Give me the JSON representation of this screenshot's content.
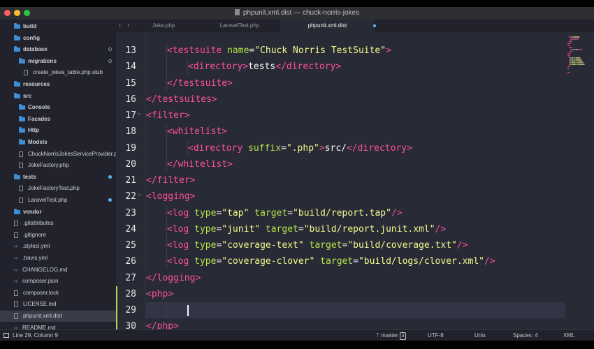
{
  "window": {
    "title": "phpunit.xml.dist — chuck-norris-jokes"
  },
  "colors": {
    "traffic_close": "#ff5f57",
    "traffic_minimize": "#febc2e",
    "traffic_zoom": "#28c840",
    "folder": "#3d8fd6",
    "modified_dot": "#5cb8f0",
    "git_added": "#b3d44b",
    "tag": "#ff4fa0",
    "attr": "#b3e34b",
    "string": "#f1fa8c"
  },
  "icons": {
    "back": "‹",
    "forward": "›",
    "fold": "⌄",
    "branch": "branch-icon"
  },
  "sidebar": {
    "items": [
      {
        "label": "build",
        "type": "folder",
        "depth": 0
      },
      {
        "label": "config",
        "type": "folder",
        "depth": 0
      },
      {
        "label": "database",
        "type": "folder",
        "depth": 0,
        "marker": "ring"
      },
      {
        "label": "migrations",
        "type": "folder",
        "depth": 1,
        "marker": "ring"
      },
      {
        "label": "create_jokes_table.php.stub",
        "type": "file",
        "depth": 2
      },
      {
        "label": "resources",
        "type": "folder",
        "depth": 0
      },
      {
        "label": "src",
        "type": "folder",
        "depth": 0
      },
      {
        "label": "Console",
        "type": "folder",
        "depth": 1
      },
      {
        "label": "Facades",
        "type": "folder",
        "depth": 1
      },
      {
        "label": "Http",
        "type": "folder",
        "depth": 1
      },
      {
        "label": "Models",
        "type": "folder",
        "depth": 1
      },
      {
        "label": "ChuckNorrisJokesServiceProvider.php",
        "type": "file",
        "depth": 1
      },
      {
        "label": "JokeFactory.php",
        "type": "file",
        "depth": 1
      },
      {
        "label": "tests",
        "type": "folder",
        "depth": 0,
        "marker": "dot"
      },
      {
        "label": "JokeFactoryTest.php",
        "type": "file",
        "depth": 1
      },
      {
        "label": "LaravelTest.php",
        "type": "file",
        "depth": 1,
        "marker": "dot"
      },
      {
        "label": "vendor",
        "type": "folder",
        "depth": 0
      },
      {
        "label": ".gitattributes",
        "type": "file",
        "depth": 0
      },
      {
        "label": ".gitignore",
        "type": "file",
        "depth": 0
      },
      {
        "label": ".styleci.yml",
        "type": "code",
        "depth": 0
      },
      {
        "label": ".travis.yml",
        "type": "code",
        "depth": 0
      },
      {
        "label": "CHANGELOG.md",
        "type": "code",
        "depth": 0
      },
      {
        "label": "composer.json",
        "type": "code",
        "depth": 0
      },
      {
        "label": "composer.lock",
        "type": "file",
        "depth": 0
      },
      {
        "label": "LICENSE.md",
        "type": "file",
        "depth": 0
      },
      {
        "label": "phpunit.xml.dist",
        "type": "file",
        "depth": 0,
        "selected": true
      },
      {
        "label": "README.md",
        "type": "code",
        "depth": 0
      }
    ]
  },
  "tabs": [
    {
      "label": "Joke.php",
      "active": false
    },
    {
      "label": "LaravelTest.php",
      "active": false
    },
    {
      "label": "phpunit.xml.dist",
      "active": true,
      "modified": true
    }
  ],
  "editor": {
    "lines": [
      {
        "n": "13",
        "indent": 1,
        "tokens": [
          [
            "tag",
            "<testsuite"
          ],
          [
            "text",
            " "
          ],
          [
            "attr",
            "name"
          ],
          [
            "punc",
            "="
          ],
          [
            "str",
            "\"Chuck Norris TestSuite\""
          ],
          [
            "tag",
            ">"
          ]
        ]
      },
      {
        "n": "14",
        "indent": 2,
        "tokens": [
          [
            "tag",
            "<directory"
          ],
          [
            "tag",
            ">"
          ],
          [
            "text",
            "tests"
          ],
          [
            "tag",
            "</directory"
          ],
          [
            "tag",
            ">"
          ]
        ]
      },
      {
        "n": "15",
        "indent": 1,
        "tokens": [
          [
            "tag",
            "</testsuite"
          ],
          [
            "tag",
            ">"
          ]
        ]
      },
      {
        "n": "16",
        "indent": 0,
        "tokens": [
          [
            "tag",
            "</testsuites"
          ],
          [
            "tag",
            ">"
          ]
        ]
      },
      {
        "n": "17",
        "indent": 0,
        "fold": true,
        "tokens": [
          [
            "tag",
            "<filter"
          ],
          [
            "tag",
            ">"
          ]
        ]
      },
      {
        "n": "18",
        "indent": 1,
        "tokens": [
          [
            "tag",
            "<whitelist"
          ],
          [
            "tag",
            ">"
          ]
        ]
      },
      {
        "n": "19",
        "indent": 2,
        "tokens": [
          [
            "tag",
            "<directory"
          ],
          [
            "text",
            " "
          ],
          [
            "attr",
            "suffix"
          ],
          [
            "punc",
            "="
          ],
          [
            "str",
            "\".php\""
          ],
          [
            "tag",
            ">"
          ],
          [
            "text",
            "src/"
          ],
          [
            "tag",
            "</directory"
          ],
          [
            "tag",
            ">"
          ]
        ]
      },
      {
        "n": "20",
        "indent": 1,
        "tokens": [
          [
            "tag",
            "</whitelist"
          ],
          [
            "tag",
            ">"
          ]
        ]
      },
      {
        "n": "21",
        "indent": 0,
        "tokens": [
          [
            "tag",
            "</filter"
          ],
          [
            "tag",
            ">"
          ]
        ]
      },
      {
        "n": "22",
        "indent": 0,
        "fold": true,
        "tokens": [
          [
            "tag",
            "<logging"
          ],
          [
            "tag",
            ">"
          ]
        ]
      },
      {
        "n": "23",
        "indent": 1,
        "tokens": [
          [
            "tag",
            "<log"
          ],
          [
            "text",
            " "
          ],
          [
            "attr",
            "type"
          ],
          [
            "punc",
            "="
          ],
          [
            "str",
            "\"tap\""
          ],
          [
            "text",
            " "
          ],
          [
            "attr",
            "target"
          ],
          [
            "punc",
            "="
          ],
          [
            "str",
            "\"build/report.tap\""
          ],
          [
            "tag",
            "/>"
          ]
        ]
      },
      {
        "n": "24",
        "indent": 1,
        "tokens": [
          [
            "tag",
            "<log"
          ],
          [
            "text",
            " "
          ],
          [
            "attr",
            "type"
          ],
          [
            "punc",
            "="
          ],
          [
            "str",
            "\"junit\""
          ],
          [
            "text",
            " "
          ],
          [
            "attr",
            "target"
          ],
          [
            "punc",
            "="
          ],
          [
            "str",
            "\"build/report.junit.xml\""
          ],
          [
            "tag",
            "/>"
          ]
        ]
      },
      {
        "n": "25",
        "indent": 1,
        "tokens": [
          [
            "tag",
            "<log"
          ],
          [
            "text",
            " "
          ],
          [
            "attr",
            "type"
          ],
          [
            "punc",
            "="
          ],
          [
            "str",
            "\"coverage-text\""
          ],
          [
            "text",
            " "
          ],
          [
            "attr",
            "target"
          ],
          [
            "punc",
            "="
          ],
          [
            "str",
            "\"build/coverage.txt\""
          ],
          [
            "tag",
            "/>"
          ]
        ]
      },
      {
        "n": "26",
        "indent": 1,
        "tokens": [
          [
            "tag",
            "<log"
          ],
          [
            "text",
            " "
          ],
          [
            "attr",
            "type"
          ],
          [
            "punc",
            "="
          ],
          [
            "str",
            "\"coverage-clover\""
          ],
          [
            "text",
            " "
          ],
          [
            "attr",
            "target"
          ],
          [
            "punc",
            "="
          ],
          [
            "str",
            "\"build/logs/clover.xml\""
          ],
          [
            "tag",
            "/>"
          ]
        ]
      },
      {
        "n": "27",
        "indent": 0,
        "tokens": [
          [
            "tag",
            "</logging"
          ],
          [
            "tag",
            ">"
          ]
        ]
      },
      {
        "n": "28",
        "indent": 0,
        "git": true,
        "tokens": [
          [
            "tag",
            "<php"
          ],
          [
            "tag",
            ">"
          ]
        ]
      },
      {
        "n": "29",
        "indent": 1,
        "git": true,
        "current": true,
        "tokens": []
      },
      {
        "n": "30",
        "indent": 0,
        "git": true,
        "tokens": [
          [
            "tag",
            "</php"
          ],
          [
            "tag",
            ">"
          ]
        ]
      }
    ]
  },
  "status": {
    "cursor": "Line 29, Column 9",
    "branch": "master",
    "branch_count": "3",
    "encoding": "UTF-8",
    "line_endings": "Unix",
    "indentation": "Spaces: 4",
    "syntax": "XML"
  }
}
